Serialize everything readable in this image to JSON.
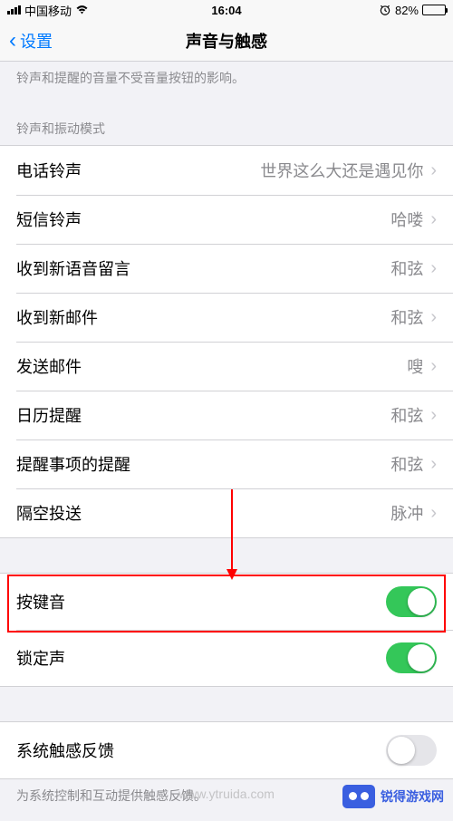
{
  "status": {
    "carrier": "中国移动",
    "time": "16:04",
    "battery_pct": "82%"
  },
  "nav": {
    "back_label": "设置",
    "title": "声音与触感"
  },
  "intro_footer": "铃声和提醒的音量不受音量按钮的影响。",
  "section1_header": "铃声和振动模式",
  "sounds": [
    {
      "label": "电话铃声",
      "value": "世界这么大还是遇见你"
    },
    {
      "label": "短信铃声",
      "value": "哈喽"
    },
    {
      "label": "收到新语音留言",
      "value": "和弦"
    },
    {
      "label": "收到新邮件",
      "value": "和弦"
    },
    {
      "label": "发送邮件",
      "value": "嗖"
    },
    {
      "label": "日历提醒",
      "value": "和弦"
    },
    {
      "label": "提醒事项的提醒",
      "value": "和弦"
    },
    {
      "label": "隔空投送",
      "value": "脉冲"
    }
  ],
  "toggles": {
    "keyboard": {
      "label": "按键音",
      "on": true
    },
    "lock": {
      "label": "锁定声",
      "on": true
    }
  },
  "haptics": {
    "label": "系统触感反馈",
    "on": false,
    "footer": "为系统控制和互动提供触感反馈。"
  },
  "watermarks": {
    "wm1": "www.ytruida.com",
    "wm2": "锐得游戏网"
  }
}
